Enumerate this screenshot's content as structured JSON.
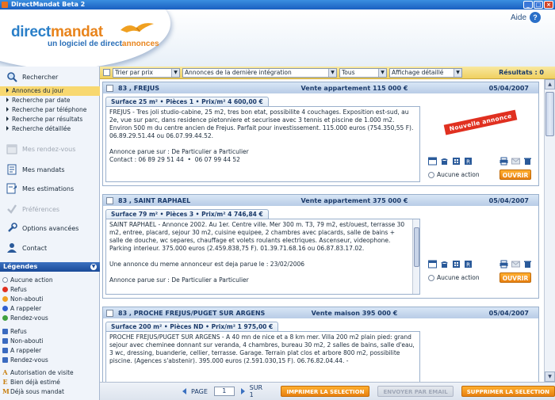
{
  "window": {
    "title": "DirectMandat Beta 2"
  },
  "header": {
    "logo_part1": "direct",
    "logo_part2": "mandat",
    "tagline_part1": "un logiciel de direct",
    "tagline_part2": "annonces",
    "help_label": "Aide",
    "help_glyph": "?"
  },
  "toolbar": {
    "sort_select": "Trier par prix",
    "period_select": "Annonces de la dernière intégration",
    "filter_select": "Tous",
    "display_select": "Affichage détaillé",
    "results_label": "Résultats : 0"
  },
  "sidebar": {
    "search": "Rechercher",
    "sub_items": [
      "Annonces du jour",
      "Recherche par date",
      "Recherche par téléphone",
      "Recherche par résultats",
      "Recherche détaillée"
    ],
    "appointments": "Mes rendez-vous",
    "mandates": "Mes mandats",
    "estimates": "Mes estimations",
    "preferences": "Préférences",
    "advanced": "Options avancées",
    "contact": "Contact",
    "legend_title": "Légendes",
    "legend_dots": [
      "Aucune action",
      "Refus",
      "Non-abouti",
      "A rappeler",
      "Rendez-vous"
    ],
    "legend_squares": [
      "Refus",
      "Non-abouti",
      "A rappeler",
      "Rendez-vous"
    ],
    "legend_letters": [
      {
        "letter": "A",
        "label": "Autorisation de visite"
      },
      {
        "letter": "E",
        "label": "Bien déjà estimé"
      },
      {
        "letter": "M",
        "label": "Déjà sous mandat"
      }
    ],
    "colors": {
      "none": "#ffffff",
      "refus": "#e03020",
      "non_abouti": "#f0a020",
      "rappeler": "#3060d0",
      "rdv": "#40a040"
    }
  },
  "listings": [
    {
      "city": "83 , FREJUS",
      "type_price": "Vente appartement 115 000 €",
      "date": "05/04/2007",
      "summary": "Surface 25 m²  •  Pièces 1  •  Prix/m² 4 600,00 €",
      "description": "FREJUS - Tres joli studio-cabine, 25 m2, tres bon etat, possibilite 4 couchages. Exposition est-sud, au 2e, vue sur parc, dans residence pietonniere et securisee avec 3 tennis et piscine de 1.000 m2. Environ 500 m du centre ancien de Frejus. Parfait pour investissement. 115.000 euros (754.350,55 F). 06.89.29.51.44 ou 06.07.99.44.52.\n\nAnnonce parue sur : De Particulier a Particulier\nContact : 06 89 29 51 44  •  06 07 99 44 52",
      "badge": "Nouvelle annonce",
      "no_action": "Aucune action",
      "open": "OUVRIR"
    },
    {
      "city": "83 , SAINT RAPHAEL",
      "type_price": "Vente appartement 375 000 €",
      "date": "05/04/2007",
      "summary": "Surface 79 m²  •  Pièces 3  •  Prix/m² 4 746,84 €",
      "description": "SAINT RAPHAEL - Annonce 2002. Au 1er. Centre ville. Mer 300 m. T3, 79 m2, est/ouest, terrasse 30 m2, entree, placard, sejour 30 m2, cuisine equipee, 2 chambres avec placards, salle de bains + salle de douche, wc separes, chauffage et volets roulants electriques. Ascenseur, videophone. Parking interieur. 375.000 euros (2.459.838,75 F). 01.39.71.68.16 ou 06.87.83.17.02.\n\nUne annonce du meme annonceur est deja parue le : 23/02/2006\n\nAnnonce parue sur : De Particulier a Particulier",
      "no_action": "Aucune action",
      "open": "OUVRIR"
    },
    {
      "city": "83 , PROCHE FREJUS/PUGET SUR ARGENS",
      "type_price": "Vente maison 395 000 €",
      "date": "05/04/2007",
      "summary": "Surface 200 m²  •  Pièces ND  •  Prix/m² 1 975,00 €",
      "description": "PROCHE FREJUS/PUGET SUR ARGENS - A 40 mn de nice et a 8 km mer. Villa 200 m2 plain pied: grand sejour avec cheminee donnant sur veranda, 4 chambres, bureau 30 m2, 2 salles de bains, salle d'eau, 3 wc, dressing, buanderie, cellier, terrasse. Garage. Terrain plat clos et arbore 800 m2, possibilite piscine. (Agences s'abstenir). 395.000 euros (2.591.030,15 F). 06.76.82.04.44. -"
    }
  ],
  "bottombar": {
    "page_label": "PAGE",
    "page_value": "1",
    "of_label": "SUR 1",
    "print_btn": "IMPRIMER LA SELECTION",
    "email_btn": "ENVOYER PAR EMAIL",
    "delete_btn": "SUPPRIMER LA SELECTION"
  }
}
